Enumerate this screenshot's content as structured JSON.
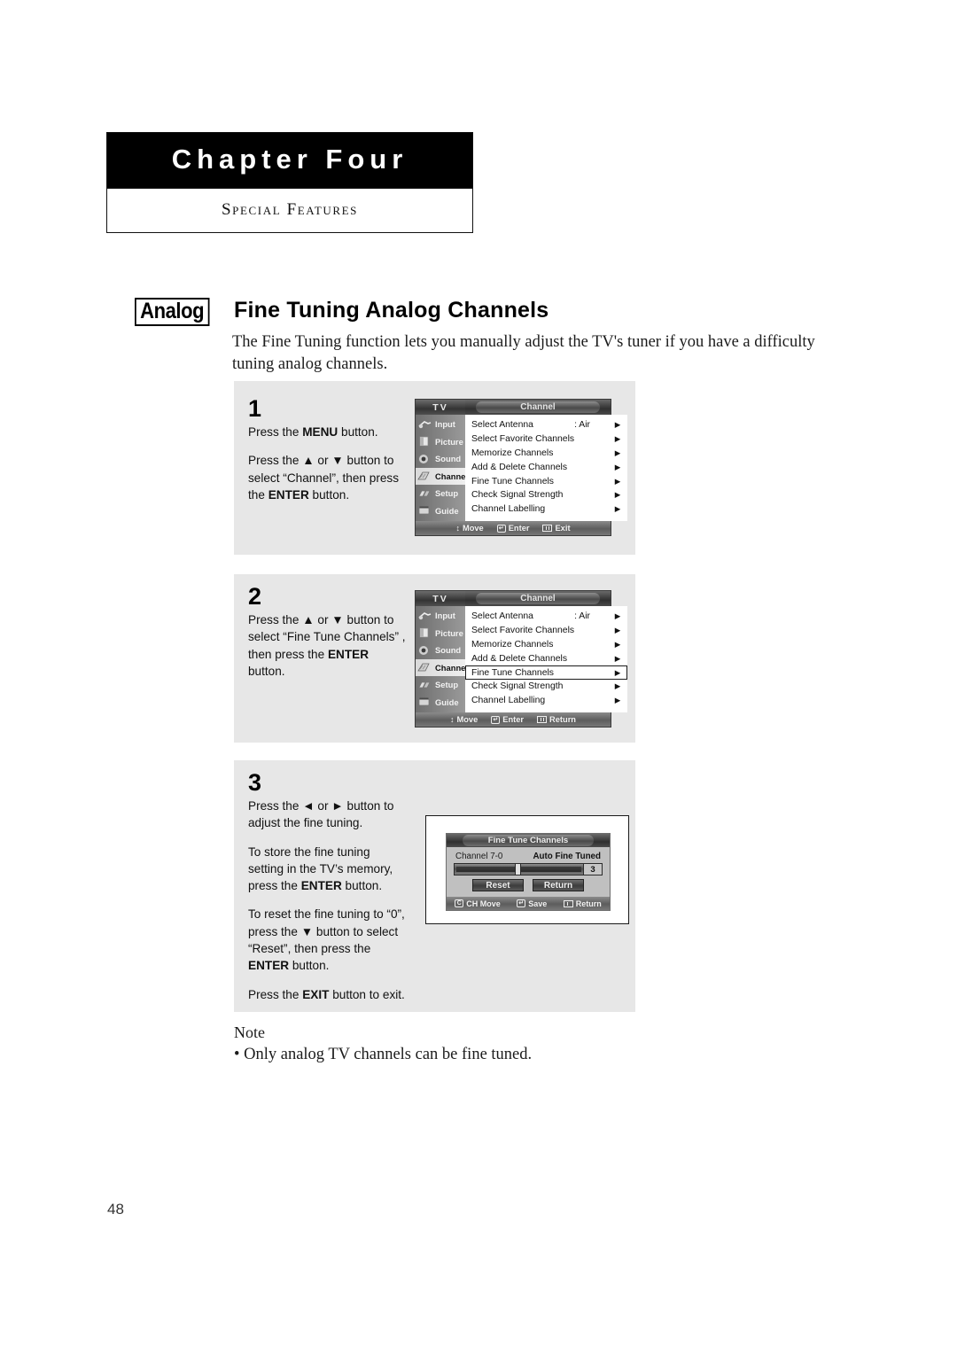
{
  "header": {
    "chapter": "Chapter Four",
    "subtitle": "Special Features"
  },
  "section": {
    "badge": "Analog",
    "title": "Fine Tuning Analog Channels",
    "intro": "The Fine Tuning function lets you manually adjust the TV's tuner if you have a difficulty tuning analog channels."
  },
  "steps": [
    {
      "number": "1",
      "paragraphs": [
        "Press the MENU button.",
        "Press the ▲ or ▼ button to select “Channel”, then press the ENTER button."
      ]
    },
    {
      "number": "2",
      "paragraphs": [
        "Press the ▲ or ▼ button to select “Fine Tune Channels” , then press the ENTER button."
      ]
    },
    {
      "number": "3",
      "paragraphs": [
        "Press the ◄ or ► button to adjust the fine tuning.",
        "To store the fine tuning setting in the TV's memory, press the ENTER button.",
        "To reset the fine tuning to “0”, press the ▼ button to select “Reset”, then press the ENTER button.",
        "Press the EXIT button to exit."
      ]
    }
  ],
  "osd": {
    "device_label": "TV",
    "menu_title": "Channel",
    "sidebar": [
      {
        "label": "Input",
        "icon": "input-icon"
      },
      {
        "label": "Picture",
        "icon": "picture-icon"
      },
      {
        "label": "Sound",
        "icon": "sound-icon"
      },
      {
        "label": "Channel",
        "icon": "channel-icon"
      },
      {
        "label": "Setup",
        "icon": "setup-icon"
      },
      {
        "label": "Guide",
        "icon": "guide-icon"
      }
    ],
    "active_sidebar_index": 3,
    "rows": [
      {
        "label": "Select Antenna",
        "value": ": Air",
        "arrow": "▶"
      },
      {
        "label": "Select Favorite Channels",
        "value": "",
        "arrow": "▶"
      },
      {
        "label": "Memorize Channels",
        "value": "",
        "arrow": "▶"
      },
      {
        "label": "Add & Delete Channels",
        "value": "",
        "arrow": "▶"
      },
      {
        "label": "Fine Tune Channels",
        "value": "",
        "arrow": "▶"
      },
      {
        "label": "Check Signal Strength",
        "value": "",
        "arrow": "▶"
      },
      {
        "label": "Channel Labelling",
        "value": "",
        "arrow": "▶"
      }
    ],
    "bottom_step1": {
      "move": "Move",
      "enter": "Enter",
      "last": "Exit"
    },
    "bottom_step2": {
      "move": "Move",
      "enter": "Enter",
      "last": "Return"
    },
    "selected_row_index_step2": 4
  },
  "fine_tune": {
    "title": "Fine Tune Channels",
    "channel_label": "Channel 7-0",
    "status_label": "Auto Fine Tuned",
    "value": "3",
    "slider_percent": 47,
    "buttons": {
      "reset": "Reset",
      "return": "Return"
    },
    "bottom": {
      "ch_move": "CH Move",
      "save": "Save",
      "return": "Return"
    }
  },
  "note": {
    "title": "Note",
    "items": [
      "• Only analog TV channels can be fine tuned."
    ]
  },
  "page_number": "48"
}
